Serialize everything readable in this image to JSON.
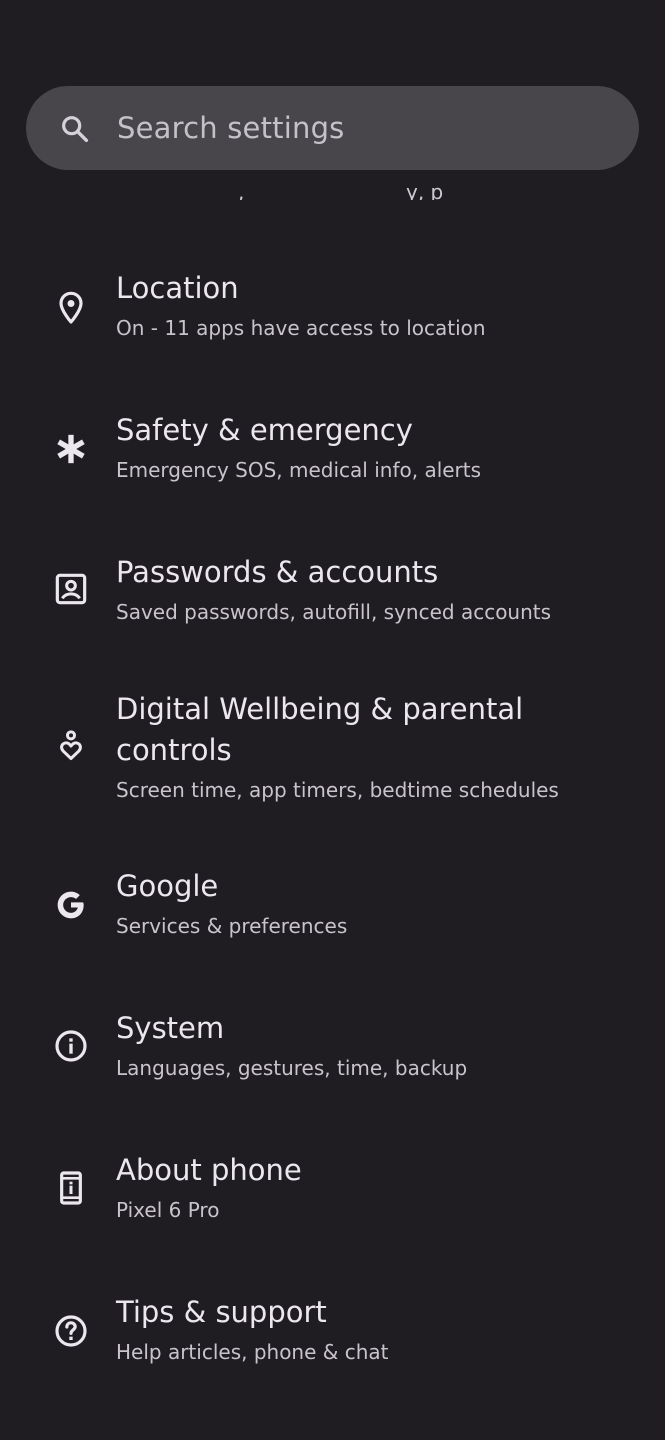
{
  "search": {
    "placeholder": "Search settings",
    "icon": "search-icon"
  },
  "settings": {
    "items": [
      {
        "title": "Location",
        "subtitle": "On - 11 apps have access to location",
        "icon": "location-pin-icon"
      },
      {
        "title": "Safety & emergency",
        "subtitle": "Emergency SOS, medical info, alerts",
        "icon": "asterisk-icon"
      },
      {
        "title": "Passwords & accounts",
        "subtitle": "Saved passwords, autofill, synced accounts",
        "icon": "account-box-icon"
      },
      {
        "title": "Digital Wellbeing & parental controls",
        "subtitle": "Screen time, app timers, bedtime schedules",
        "icon": "wellbeing-icon"
      },
      {
        "title": "Google",
        "subtitle": "Services & preferences",
        "icon": "google-icon"
      },
      {
        "title": "System",
        "subtitle": "Languages, gestures, time, backup",
        "icon": "info-icon"
      },
      {
        "title": "About phone",
        "subtitle": "Pixel 6 Pro",
        "icon": "phone-icon"
      },
      {
        "title": "Tips & support",
        "subtitle": "Help articles, phone & chat",
        "icon": "help-icon"
      }
    ]
  },
  "colors": {
    "background": "#1f1d22",
    "search_bar": "#48464b",
    "title_text": "#ece6ee",
    "subtitle_text": "#c9c3cc"
  }
}
